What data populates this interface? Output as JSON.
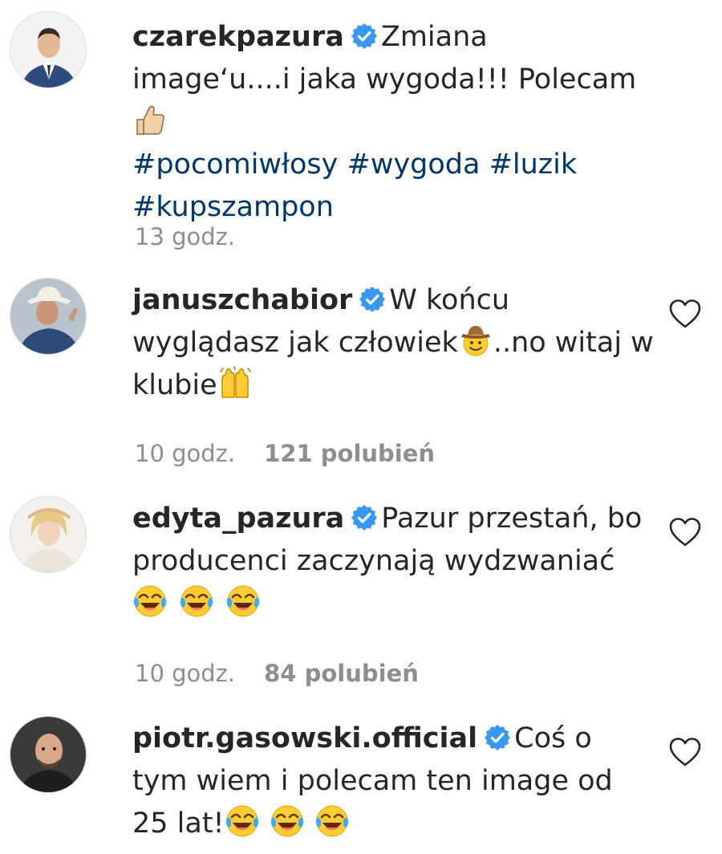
{
  "comments": [
    {
      "username": "czarekpazura",
      "text_parts": [
        "Zmiana image‘u....i jaka wygoda!!! Polecam"
      ],
      "hashtags": "#pocomiwłosy #wygoda #luzik #kupszampon",
      "time": "13 godz.",
      "likes": "",
      "emoji": "thumbs-up-emoji",
      "avatar_icon": "man-in-suit-avatar"
    },
    {
      "username": "januszchabior",
      "text_parts": [
        "W końcu wyglądasz jak człowiek",
        "..no witaj w klubie"
      ],
      "time": "10 godz.",
      "likes": "121 polubień",
      "emoji": [
        "cowboy-face-emoji",
        "raised-hands-emoji"
      ],
      "avatar_icon": "man-in-hat-avatar"
    },
    {
      "username": "edyta_pazura",
      "text_parts": [
        "Pazur przestań, bo producenci zaczynają wydzwaniać"
      ],
      "time": "10 godz.",
      "likes": "84 polubień",
      "emoji": [
        "tears-of-joy-emoji",
        "tears-of-joy-emoji",
        "tears-of-joy-emoji"
      ],
      "avatar_icon": "woman-blonde-avatar"
    },
    {
      "username": "piotr.gasowski.official",
      "text_parts": [
        "Coś o tym wiem i polecam ten image od 25 lat!"
      ],
      "time": "",
      "likes": "",
      "emoji": [
        "tears-of-joy-emoji",
        "tears-of-joy-emoji",
        "tears-of-joy-emoji"
      ],
      "avatar_icon": "bald-man-avatar"
    }
  ],
  "colors": {
    "verified": "#3897f0",
    "hashtag": "#00376b",
    "meta": "#8e8e8e",
    "text": "#262626"
  }
}
